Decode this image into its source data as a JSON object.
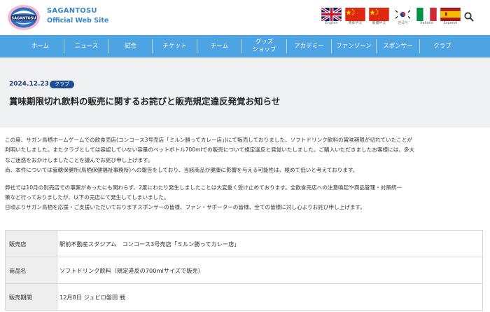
{
  "header": {
    "brand_name": "SAGANTOSU",
    "brand_sub": "Official Web Site",
    "logo_text": "SAGANTOSU",
    "languages": [
      {
        "label": "English",
        "flag": "uk"
      },
      {
        "label": "简体中文",
        "flag": "cn"
      },
      {
        "label": "繁體中文",
        "flag": "tw"
      },
      {
        "label": "한국어",
        "flag": "kr"
      },
      {
        "label": "Italiano",
        "flag": "it"
      },
      {
        "label": "Español",
        "flag": "es"
      }
    ],
    "search_icon": "search-icon"
  },
  "nav": {
    "items": [
      {
        "line1": "ホーム",
        "line2": ""
      },
      {
        "line1": "ニュース",
        "line2": ""
      },
      {
        "line1": "試合",
        "line2": ""
      },
      {
        "line1": "チケット",
        "line2": ""
      },
      {
        "line1": "チーム",
        "line2": ""
      },
      {
        "line1": "グッズ",
        "line2": "ショップ"
      },
      {
        "line1": "アカデミー",
        "line2": ""
      },
      {
        "line1": "ファンゾーン",
        "line2": ""
      },
      {
        "line1": "スポンサー",
        "line2": ""
      },
      {
        "line1": "クラブ",
        "line2": ""
      }
    ]
  },
  "article": {
    "date": "2024.12.23",
    "category": "クラブ",
    "title": "賞味期限切れ飲料の販売に関するお詫びと販売規定違反発覚お知らせ",
    "paragraphs": [
      [
        "この度、サガン鳥栖ホームゲームでの飲食売店(コンコース3号売店「ミルン勝ってカレー店」)にて販売しておりました、ソフトドリンク飲料の賞味期限が切れていたことが",
        "判明いたしました。またクラブとしては容認していない容量のペットボトル700mlでの販売について規定違反と発覚いたしました。ご購入いただきましたお客様には、多大",
        "なご迷惑をおかけしましたことを謹んでお詫び申し上げます。",
        "尚、本件については管轄保健所(鳥栖保健福祉事務所)への報告をしており、当該商品が健康に影響を与える可能性は、極めて低いと考えております。"
      ],
      [
        "弊社では10月の別売店での事案があったにも関わらず、2度にわたり発生しましたことは大変重く受け止めております。全飲食売店への注意喚起や商品管理・対策統一",
        "策など行っておりましたが、以下の売店にて発生してしまいました。",
        "日頃よりサガン鳥栖を応援・ご支援いただいておりますスポンサーの皆様、ファン・サポーターの皆様、全ての皆様に対し心よりお詫び申し上げます。"
      ]
    ]
  },
  "table": {
    "rows": [
      {
        "label": "販売店",
        "value": "駅前不動産スタジアム　コンコース3号売店「ミルン勝ってカレー店」"
      },
      {
        "label": "商品名",
        "value": "ソフトドリンク飲料（規定違反の700mlサイズで販売）"
      },
      {
        "label": "販売期間",
        "value": "12月8日 ジュビロ磐田 戦"
      }
    ]
  },
  "colors": {
    "nav_bg": "#4ea3e3",
    "brand": "#3a86c8",
    "badge": "#1e4f96",
    "date": "#1e3f78"
  }
}
